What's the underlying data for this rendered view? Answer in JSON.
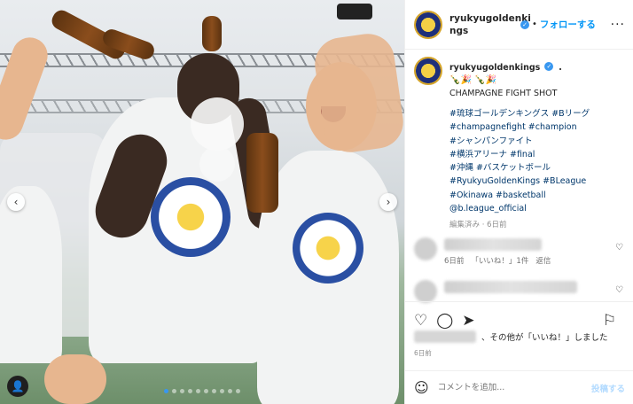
{
  "header": {
    "username_line1": "ryukyugoldenki",
    "username_line2": "ngs",
    "verified_icon": "verified-badge-icon",
    "follow_label": "フォローする",
    "more_icon": "more-options-icon"
  },
  "caption": {
    "username": "ryukyugoldenkings",
    "emoji_line": "🍾🎉 🍾🎉",
    "title": "CHAMPAGNE FIGHT SHOT",
    "tags": [
      "#琉球ゴールデンキングス #Bリーグ",
      "#champagnefight #champion",
      "#シャンパンファイト",
      "#横浜アリーナ #final",
      "#沖縄 #バスケットボール",
      "#RyukyuGoldenKings #BLeague",
      "#Okinawa #basketball",
      "@b.league_official"
    ],
    "meta": "編集済み · 6日前"
  },
  "comments": [
    {
      "time": "6日前",
      "likes": "「いいね！」1件",
      "reply": "返信"
    },
    {
      "time": "",
      "likes": "",
      "reply": ""
    }
  ],
  "actions": {
    "like_icon": "heart-icon",
    "comment_icon": "comment-icon",
    "share_icon": "share-icon",
    "save_icon": "bookmark-icon"
  },
  "likes_text": "、その他が「いいね！」しました",
  "date": "6日前",
  "comment_bar": {
    "placeholder": "コメントを追加...",
    "post_label": "投稿する"
  },
  "carousel": {
    "dot_count": 10,
    "active_index": 0
  },
  "colors": {
    "accent": "#0095f6",
    "link": "#00376b",
    "muted": "#8e8e8e"
  }
}
